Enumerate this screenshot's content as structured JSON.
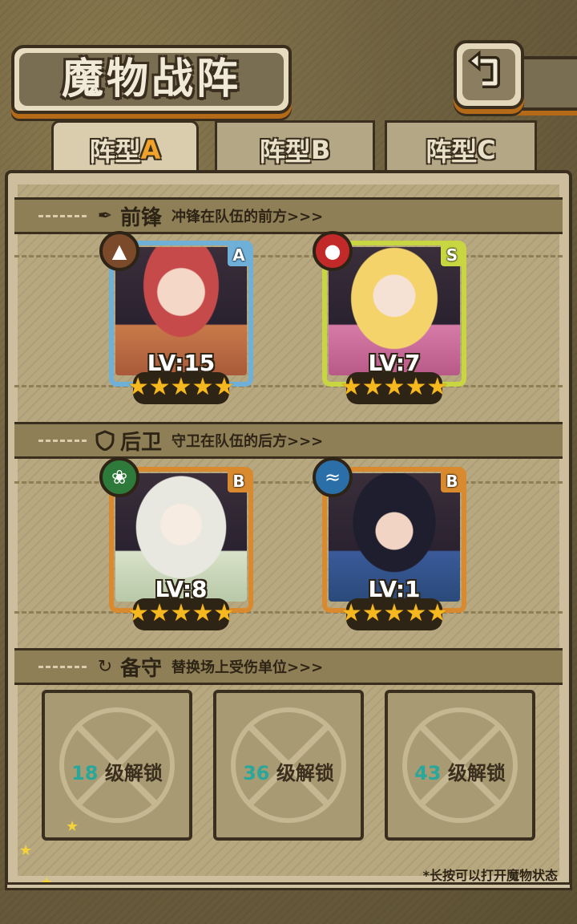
{
  "header": {
    "title": "魔物战阵",
    "back_icon": "back-arrow-icon"
  },
  "tabs": [
    {
      "prefix": "阵型",
      "letter": "A",
      "active": true
    },
    {
      "prefix": "阵型",
      "letter": "B",
      "active": false
    },
    {
      "prefix": "阵型",
      "letter": "C",
      "active": false
    }
  ],
  "sections": {
    "front": {
      "icon": "feather-icon",
      "title": "前锋",
      "desc": "冲锋在队伍的前方>>>"
    },
    "back": {
      "icon": "shield-icon",
      "title": "后卫",
      "desc": "守卫在队伍的后方>>>"
    },
    "reserve": {
      "icon": "refresh-icon",
      "title": "备守",
      "desc": "替换场上受伤单位>>>"
    }
  },
  "front_units": [
    {
      "level": "LV:15",
      "grade": "A",
      "element": "earth",
      "stars": 5,
      "frame_color": "#6fb0d8",
      "grade_color": "#6fb0d8",
      "element_color": "#7a4a2a"
    },
    {
      "level": "LV:7",
      "grade": "S",
      "element": "fire",
      "stars": 5,
      "frame_color": "#c8d642",
      "grade_color": "#c8d642",
      "element_color": "#c22a2a"
    }
  ],
  "back_units": [
    {
      "level": "LV:8",
      "grade": "B",
      "element": "nature",
      "stars": 5,
      "frame_color": "#d98a2e",
      "grade_color": "#d98a2e",
      "element_color": "#2e7a3a"
    },
    {
      "level": "LV:1",
      "grade": "B",
      "element": "water",
      "stars": 5,
      "frame_color": "#d98a2e",
      "grade_color": "#d98a2e",
      "element_color": "#2a6fa8"
    }
  ],
  "reserve_slots": [
    {
      "level": "18",
      "suffix": "级解锁"
    },
    {
      "level": "36",
      "suffix": "级解锁"
    },
    {
      "level": "43",
      "suffix": "级解锁"
    }
  ],
  "footer_note": "*长按可以打开魔物状态"
}
